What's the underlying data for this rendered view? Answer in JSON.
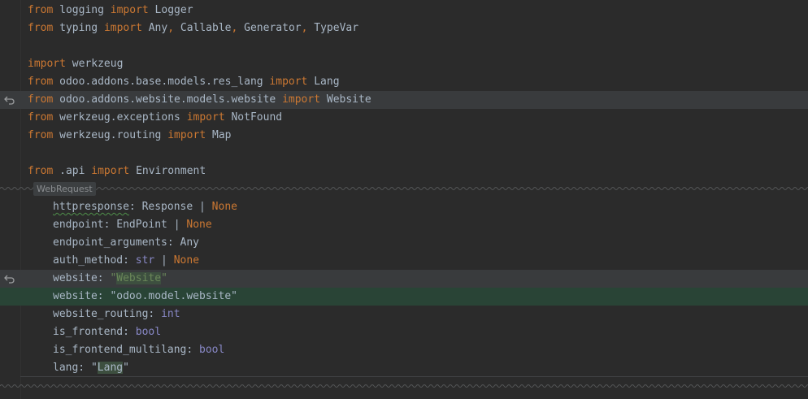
{
  "editor": {
    "outer_lines": [
      [
        {
          "t": "from",
          "c": "kw"
        },
        {
          "t": " logging ",
          "c": ""
        },
        {
          "t": "import",
          "c": "kw"
        },
        {
          "t": " Logger",
          "c": ""
        }
      ],
      [
        {
          "t": "from",
          "c": "kw"
        },
        {
          "t": " typing ",
          "c": ""
        },
        {
          "t": "import",
          "c": "kw"
        },
        {
          "t": " Any",
          "c": ""
        },
        {
          "t": ",",
          "c": "kw"
        },
        {
          "t": " Callable",
          "c": ""
        },
        {
          "t": ",",
          "c": "kw"
        },
        {
          "t": " Generator",
          "c": ""
        },
        {
          "t": ",",
          "c": "kw"
        },
        {
          "t": " TypeVar",
          "c": ""
        }
      ],
      [],
      [
        {
          "t": "import",
          "c": "kw"
        },
        {
          "t": " werkzeug",
          "c": ""
        }
      ],
      [
        {
          "t": "from",
          "c": "kw"
        },
        {
          "t": " odoo.addons.base.models.res_lang ",
          "c": ""
        },
        {
          "t": "import",
          "c": "kw"
        },
        {
          "t": " Lang",
          "c": ""
        }
      ],
      [
        {
          "t": "from",
          "c": "kw"
        },
        {
          "t": " odoo.addons.website.models.website ",
          "c": ""
        },
        {
          "t": "import",
          "c": "kw"
        },
        {
          "t": " Website",
          "c": ""
        }
      ],
      [
        {
          "t": "from",
          "c": "kw"
        },
        {
          "t": " werkzeug.exceptions ",
          "c": ""
        },
        {
          "t": "import",
          "c": "kw"
        },
        {
          "t": " NotFound",
          "c": ""
        }
      ],
      [
        {
          "t": "from",
          "c": "kw"
        },
        {
          "t": " werkzeug.routing ",
          "c": ""
        },
        {
          "t": "import",
          "c": "kw"
        },
        {
          "t": " Map",
          "c": ""
        }
      ],
      [],
      [
        {
          "t": "from",
          "c": "kw"
        },
        {
          "t": " .api ",
          "c": ""
        },
        {
          "t": "import",
          "c": "kw"
        },
        {
          "t": " Environment",
          "c": ""
        }
      ]
    ],
    "fold_tag": "WebRequest",
    "inner_lines": [
      [
        {
          "t": "httpresponse",
          "c": "warn"
        },
        {
          "t": ": Response | ",
          "c": ""
        },
        {
          "t": "None",
          "c": "kw"
        }
      ],
      [
        {
          "t": "endpoint: EndPoint | ",
          "c": ""
        },
        {
          "t": "None",
          "c": "kw"
        }
      ],
      [
        {
          "t": "endpoint_arguments: Any",
          "c": ""
        }
      ],
      [
        {
          "t": "auth_method: ",
          "c": ""
        },
        {
          "t": "str",
          "c": "bi"
        },
        {
          "t": " | ",
          "c": ""
        },
        {
          "t": "None",
          "c": "kw"
        }
      ],
      [
        {
          "t": "website: ",
          "c": ""
        },
        {
          "t": "\"",
          "c": "str"
        },
        {
          "t": "Website",
          "c": "str hl-str"
        },
        {
          "t": "\"",
          "c": "str"
        }
      ],
      [
        {
          "t": "website: \"odoo.model.website\"",
          "c": ""
        }
      ],
      [
        {
          "t": "website_routing: ",
          "c": ""
        },
        {
          "t": "int",
          "c": "bi"
        }
      ],
      [
        {
          "t": "is_frontend: ",
          "c": ""
        },
        {
          "t": "bool",
          "c": "bi"
        }
      ],
      [
        {
          "t": "is_frontend_multilang: ",
          "c": ""
        },
        {
          "t": "bool",
          "c": "bi"
        }
      ],
      [
        {
          "t": "lang: \"",
          "c": ""
        },
        {
          "t": "Lang",
          "c": "hl-str"
        },
        {
          "t": "\"",
          "c": ""
        }
      ]
    ],
    "changed_outer": [
      5
    ],
    "changed_inner": [
      4
    ],
    "added_inner": [
      5
    ],
    "colors": {
      "background": "#2b2b2b",
      "keyword": "#cc7832",
      "string": "#6a8759",
      "builtin": "#8888c6",
      "text": "#a9b7c6",
      "changed_line": "#393b3d",
      "added_line": "#294436"
    },
    "icons": {
      "revert": "revert-arrow-icon"
    }
  }
}
